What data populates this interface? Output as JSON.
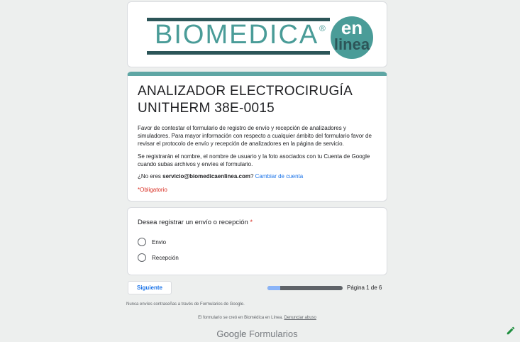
{
  "banner": {
    "logo_main": "BIOMEDICA",
    "logo_reg": "®",
    "logo_en": "en",
    "logo_linea": "linea"
  },
  "form": {
    "title": "ANALIZADOR ELECTROCIRUGÍA UNITHERM 38E-0015",
    "description": "Favor de contestar el formulario de registro de envío y recepción de analizadores y simuladores. Para mayor información con respecto a cualquier ámbito del formulario favor de revisar el protocolo de envío y recepción de analizadores en la página de servicio.",
    "notice": "Se registrarán el nombre, el nombre de usuario y la foto asociados con tu Cuenta de Google cuando subas archivos y envíes el formulario.",
    "account_prefix": "¿No eres ",
    "account_email": "servicio@biomedicaenlinea.com",
    "account_suffix": "? ",
    "switch_account": "Cambiar de cuenta",
    "required_note": "*Obligatorio"
  },
  "question": {
    "label": "Desea registrar un envío o recepción",
    "required_mark": "*",
    "options": [
      "Envio",
      "Recepción"
    ]
  },
  "navigation": {
    "next_label": "Siguiente",
    "page_indicator": "Página 1 de 6",
    "progress_fraction": 0.17
  },
  "footer": {
    "password_warning": "Nunca envíes contraseñas a través de Formularios de Google.",
    "created_by": "El formulario se creó en Biomédica en Línea. ",
    "report_abuse": "Denunciar abuso",
    "brand_google": "Google",
    "brand_forms": "Formularios"
  },
  "colors": {
    "header_accent": "#5ea6a4",
    "link": "#1a73e8",
    "required": "#d93025"
  },
  "icons": {
    "edit": "pencil-icon"
  }
}
